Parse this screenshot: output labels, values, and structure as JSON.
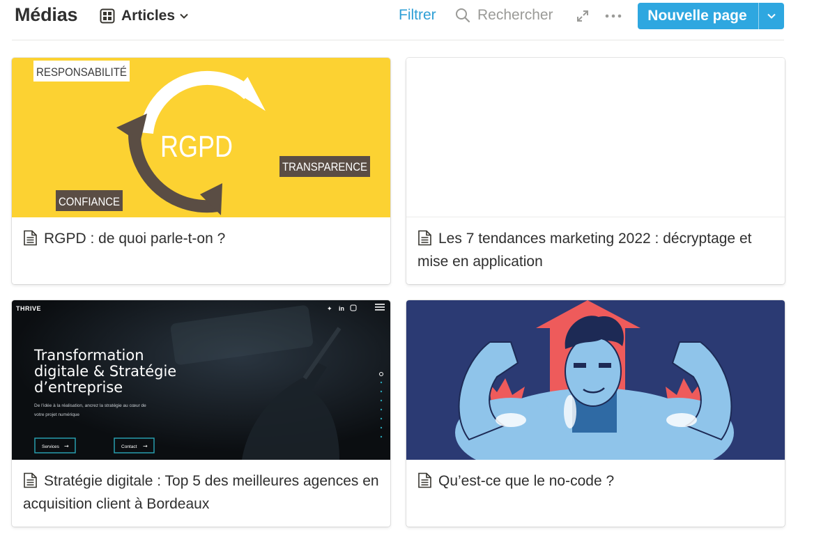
{
  "header": {
    "title": "Médias",
    "view_label": "Articles",
    "filter_label": "Filtrer",
    "search_label": "Rechercher",
    "new_page_label": "Nouvelle page",
    "accent_color": "#2ea7e0"
  },
  "cards": [
    {
      "title": "RGPD : de quoi parle-t-on ?",
      "cover": {
        "background": "#fcd232",
        "labels": [
          "RESPONSABILITÉ",
          "RGPD",
          "TRANSPARENCE",
          "CONFIANCE"
        ]
      }
    },
    {
      "title": "Les 7 tendances marketing 2022 : décryptage et mise en application",
      "cover": {
        "background": "#ffffff"
      }
    },
    {
      "title": "Stratégie digitale : Top 5 des meilleures agences en acquisition client à Bordeaux",
      "cover": {
        "background": "#0e1216",
        "brand": "THRIVE",
        "headline_1": "Transformation",
        "headline_2": "digitale & Stratégie",
        "headline_3": "d’entreprise",
        "subtext_1": "De l’idée à la réalisation, ancrez la stratégie au cœur de",
        "subtext_2": "votre projet numérique",
        "btn_services": "Services",
        "btn_contact": "Contact",
        "social": "in"
      }
    },
    {
      "title": "Qu’est-ce que le no-code ?",
      "cover": {
        "background": "#2b3a73"
      }
    }
  ]
}
